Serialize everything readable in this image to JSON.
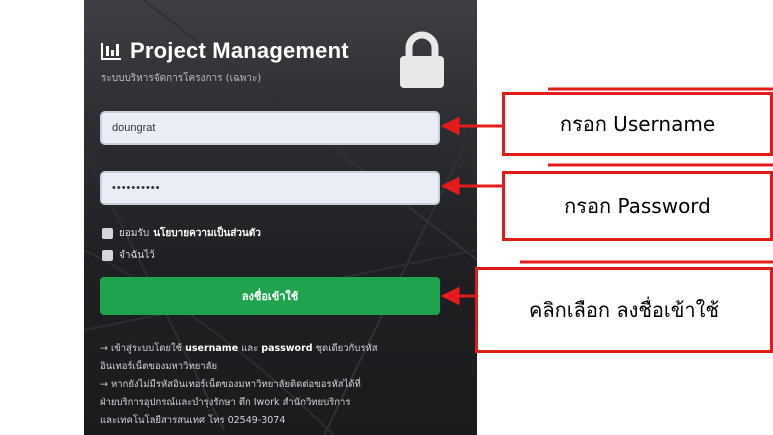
{
  "app": {
    "title": "Project Management",
    "subtitle": "ระบบบริหารจัดการโครงการ (เฉพาะ)"
  },
  "login": {
    "username_value": "doungrat",
    "password_value": "••••••••••",
    "accept_prefix": "ยอมรับ",
    "privacy_link": "นโยบายความเป็นส่วนตัว",
    "remember_label": "จำฉันไว้",
    "submit_label": "ลงชื่อเข้าใช้"
  },
  "info": {
    "line1_prefix": "→ เข้าสู่ระบบโดยใช้",
    "line1_username": "username",
    "line1_and": "และ",
    "line1_password": "password",
    "line1_suffix": "ชุดเดียวกับรหัส",
    "line2": "อินเทอร์เน็ตของมหาวิทยาลัย",
    "line3": "→ หากยังไม่มีรหัสอินเทอร์เน็ตของมหาวิทยาลัยติดต่อขอรหัสได้ที่",
    "line4": "ฝ่ายบริการอุปกรณ์และบำรุงรักษา ตึก Iwork สำนักวิทยบริการ",
    "line5": "และเทคโนโลยีสารสนเทศ โทร 02549-3074"
  },
  "callouts": {
    "username": "กรอก Username",
    "password": "กรอก Password",
    "login": "คลิกเลือก ลงชื่อเข้าใช้"
  },
  "colors": {
    "accent_red": "#e31b1b",
    "login_green": "#1fa34f",
    "panel_dark": "#2c2e31"
  },
  "icons": {
    "brand": "bar-chart-icon",
    "lock": "padlock-icon"
  }
}
